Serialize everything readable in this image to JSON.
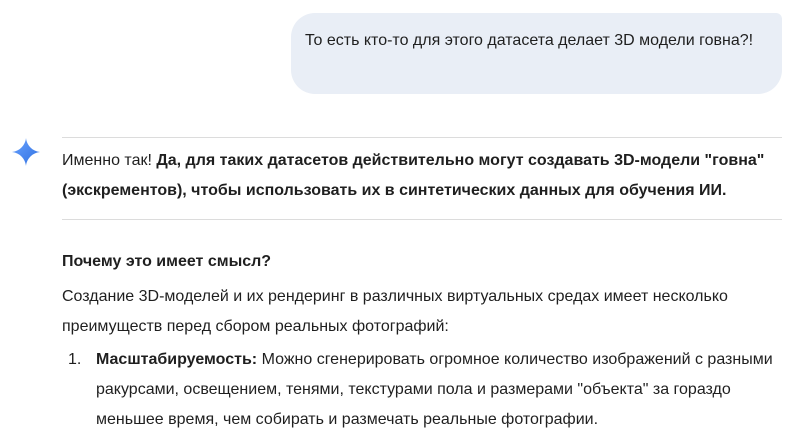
{
  "user_message": {
    "text": "То есть кто-то для этого датасета делает 3D модели говна?!"
  },
  "response": {
    "intro_plain": "Именно так! ",
    "intro_bold": "Да, для таких датасетов действительно могут создавать 3D-модели \"говна\" (экскрементов), чтобы использовать их в синтетических данных для обучения ИИ.",
    "section_heading": "Почему это имеет смысл?",
    "paragraph": "Создание 3D-моделей и их рендеринг в различных виртуальных средах имеет несколько преимуществ перед сбором реальных фотографий:",
    "list": [
      {
        "number": "1.",
        "title": "Масштабируемость:",
        "text": " Можно сгенерировать огромное количество изображений с разными ракурсами, освещением, тенями, текстурами пола и размерами \"объекта\" за гораздо меньшее время, чем собирать и размечать реальные фотографии."
      }
    ]
  },
  "icons": {
    "assistant": "gemini-sparkle-icon"
  },
  "colors": {
    "user_bubble": "#e9eef6",
    "divider": "#dcdcdc",
    "text": "#1f1f1f",
    "sparkle_top": "#4a8ef5",
    "sparkle_bottom": "#2f6fe0"
  }
}
